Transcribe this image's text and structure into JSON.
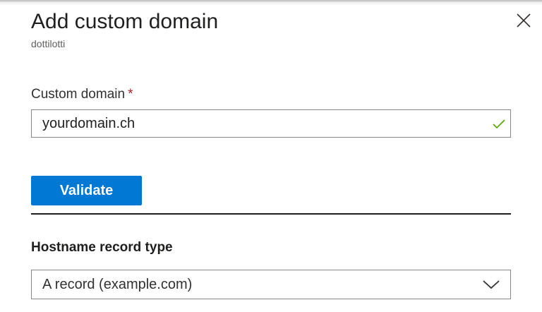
{
  "panel": {
    "title": "Add custom domain",
    "subtitle": "dottilotti"
  },
  "icons": {
    "close": "close-icon",
    "check": "checkmark-icon",
    "dropdown": "chevron-down-icon"
  },
  "custom_domain": {
    "label": "Custom domain",
    "required_marker": "*",
    "value": "yourdomain.ch",
    "valid": true
  },
  "validate_button": {
    "label": "Validate"
  },
  "hostname_record_type": {
    "label": "Hostname record type",
    "selected": "A record (example.com)"
  },
  "colors": {
    "accent": "#0078d4",
    "required": "#a4262c",
    "valid_check": "#57a300"
  }
}
